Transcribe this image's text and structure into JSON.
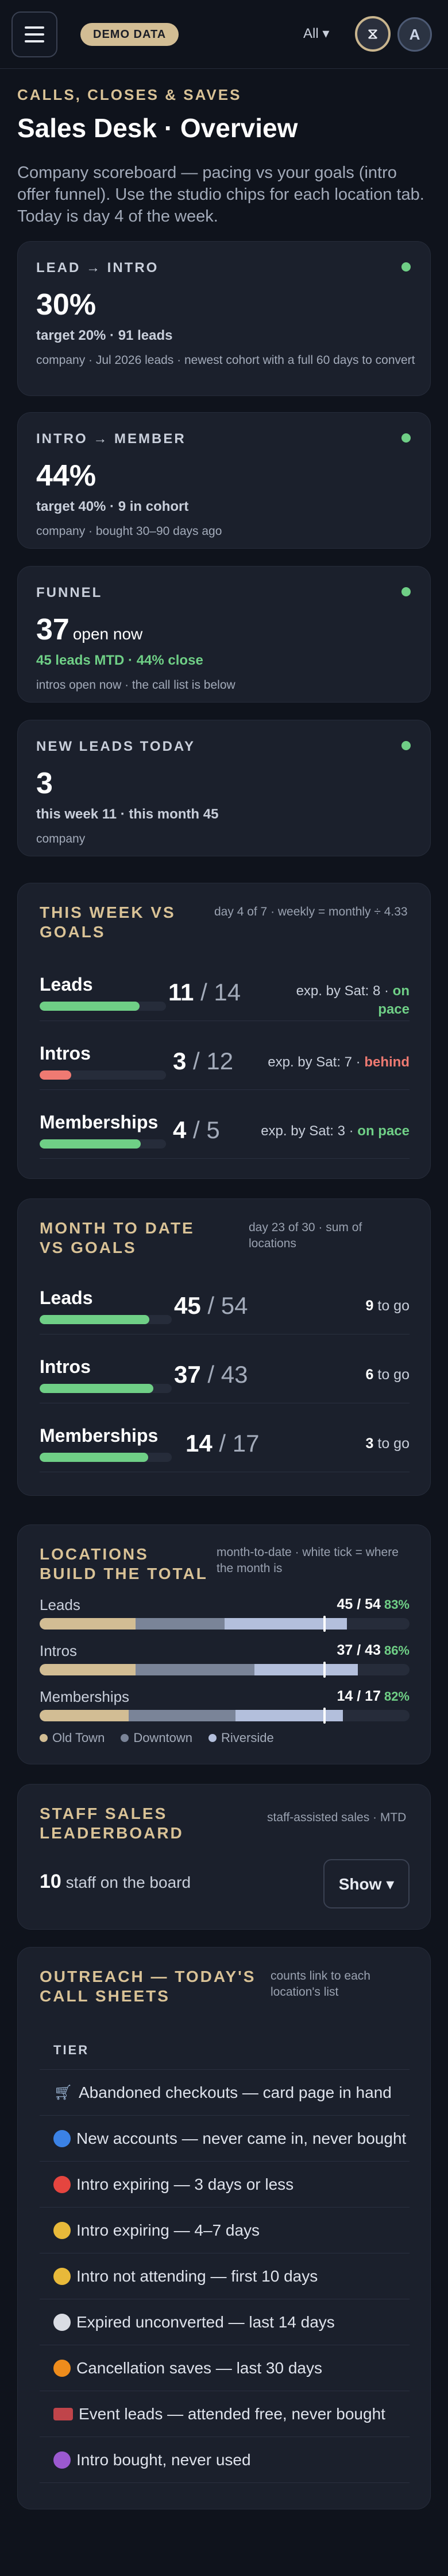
{
  "header": {
    "demo_badge": "DEMO DATA",
    "filter_label": "All ▾",
    "logo_glyph": "⧖",
    "avatar_initial": "A"
  },
  "intro": {
    "eyebrow": "CALLS, CLOSES & SAVES",
    "title": "Sales Desk · Overview",
    "subtitle": "Company scoreboard — pacing vs your goals (intro offer funnel). Use the studio chips for each location tab. Today is day 4 of the week."
  },
  "kpis": [
    {
      "label": "LEAD → INTRO",
      "value": "30%",
      "value_suffix": "",
      "target": "target 20% · 91 leads",
      "note": "company · Jul 2026 leads · newest cohort with a full 60 days to convert",
      "target_green": false
    },
    {
      "label": "INTRO → MEMBER",
      "value": "44%",
      "value_suffix": "",
      "target": "target 40% · 9 in cohort",
      "note": "company · bought 30–90 days ago",
      "target_green": false
    },
    {
      "label": "FUNNEL",
      "value": "37",
      "value_suffix": "open now",
      "target": "45 leads MTD · 44% close",
      "note": "intros open now · the call list is below",
      "target_green": true
    },
    {
      "label": "NEW LEADS TODAY",
      "value": "3",
      "value_suffix": "",
      "target": "this week 11 · this month 45",
      "note": "company",
      "target_green": false
    }
  ],
  "week": {
    "title": "THIS WEEK VS GOALS",
    "note": "day 4 of 7 · weekly = monthly ÷ 4.33",
    "rows": [
      {
        "name": "Leads",
        "actual": "11",
        "goal": "14",
        "exp": "exp. by Sat: 8 ·",
        "status": "on pace",
        "status_type": "on",
        "progress": 0.79,
        "color": "#6fcf86"
      },
      {
        "name": "Intros",
        "actual": "3",
        "goal": "12",
        "exp": "exp. by Sat: 7 ·",
        "status": "behind",
        "status_type": "behind",
        "progress": 0.25,
        "color": "#ef7a72"
      },
      {
        "name": "Memberships",
        "actual": "4",
        "goal": "5",
        "exp": "exp. by Sat: 3 ·",
        "status": "on pace",
        "status_type": "on",
        "progress": 0.8,
        "color": "#6fcf86"
      }
    ]
  },
  "month": {
    "title": "MONTH TO DATE VS GOALS",
    "note": "day 23 of 30 · sum of locations",
    "rows": [
      {
        "name": "Leads",
        "actual": "45",
        "goal": "54",
        "togo_num": "9",
        "togo_text": "to go",
        "progress": 0.83
      },
      {
        "name": "Intros",
        "actual": "37",
        "goal": "43",
        "togo_num": "6",
        "togo_text": "to go",
        "progress": 0.86
      },
      {
        "name": "Memberships",
        "actual": "14",
        "goal": "17",
        "togo_num": "3",
        "togo_text": "to go",
        "progress": 0.82
      }
    ]
  },
  "locations": {
    "title": "LOCATIONS BUILD THE TOTAL",
    "note": "month-to-date · white tick = where the month is",
    "rows": [
      {
        "name": "Leads",
        "value": "45 / 54",
        "pct": "83%",
        "segments": [
          0.26,
          0.24,
          0.33
        ],
        "tick": 0.77
      },
      {
        "name": "Intros",
        "value": "37 / 43",
        "pct": "86%",
        "segments": [
          0.26,
          0.32,
          0.28
        ],
        "tick": 0.77
      },
      {
        "name": "Memberships",
        "value": "14 / 17",
        "pct": "82%",
        "segments": [
          0.24,
          0.29,
          0.29
        ],
        "tick": 0.77
      }
    ],
    "legend": [
      {
        "name": "Old Town",
        "color": "#d2bd94"
      },
      {
        "name": "Downtown",
        "color": "#7a8498"
      },
      {
        "name": "Riverside",
        "color": "#b3bfdc"
      }
    ]
  },
  "leaderboard": {
    "title": "STAFF SALES LEADERBOARD",
    "note": "staff-assisted sales · MTD",
    "count": "10",
    "count_label": "staff on the board",
    "show_label": "Show ▾"
  },
  "outreach": {
    "title": "OUTREACH — TODAY'S CALL SHEETS",
    "note": "counts link to each location's list",
    "column_header": "TIER",
    "tiers": [
      {
        "label": "Abandoned checkouts — card page in hand",
        "icon": "cart-icon",
        "color": "#9fb9d8"
      },
      {
        "label": "New accounts — never came in, never bought",
        "icon": "blue-circle-icon",
        "color": "#3b82e6"
      },
      {
        "label": "Intro expiring — 3 days or less",
        "icon": "red-circle-icon",
        "color": "#e5453f"
      },
      {
        "label": "Intro expiring — 4–7 days",
        "icon": "yellow-circle-icon",
        "color": "#e8b93a"
      },
      {
        "label": "Intro not attending — first 10 days",
        "icon": "yellow-circle-icon",
        "color": "#e8b93a"
      },
      {
        "label": "Expired unconverted — last 14 days",
        "icon": "white-circle-icon",
        "color": "#d9dce3"
      },
      {
        "label": "Cancellation saves — last 30 days",
        "icon": "orange-circle-icon",
        "color": "#ee8c1c"
      },
      {
        "label": "Event leads — attended free, never bought",
        "icon": "ticket-icon",
        "color": "#c0444a"
      },
      {
        "label": "Intro bought, never used",
        "icon": "purple-circle-icon",
        "color": "#9b59d0"
      }
    ]
  }
}
